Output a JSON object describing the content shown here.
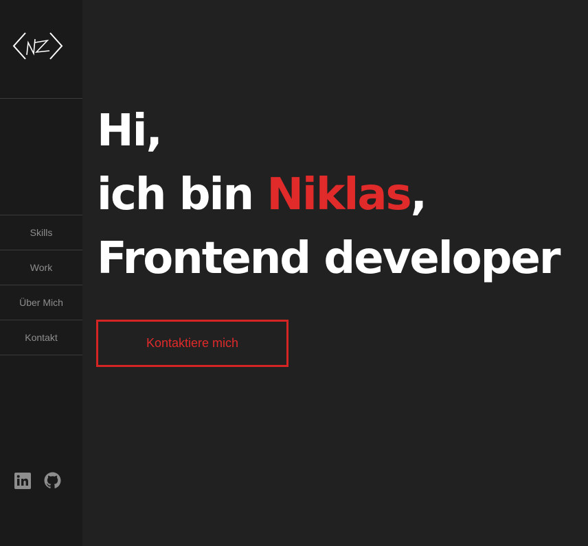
{
  "logo": {
    "icon": "nz-logo-icon",
    "text": "NZ"
  },
  "nav": {
    "items": [
      {
        "label": "Skills"
      },
      {
        "label": "Work"
      },
      {
        "label": "Über Mich"
      },
      {
        "label": "Kontakt"
      }
    ]
  },
  "social": {
    "linkedin_icon": "linkedin-icon",
    "github_icon": "github-icon"
  },
  "hero": {
    "line1": "Hi,",
    "line2_prefix": "ich bin ",
    "name": "Niklas",
    "line2_suffix": ",",
    "line3": "Frontend developer"
  },
  "cta": {
    "label": "Kontaktiere mich"
  },
  "colors": {
    "background": "#212121",
    "sidebar": "#1a1a1a",
    "accent": "#e12a2a",
    "text": "#ffffff",
    "nav_text": "#8e8e8e",
    "divider": "#3c3c3c"
  }
}
